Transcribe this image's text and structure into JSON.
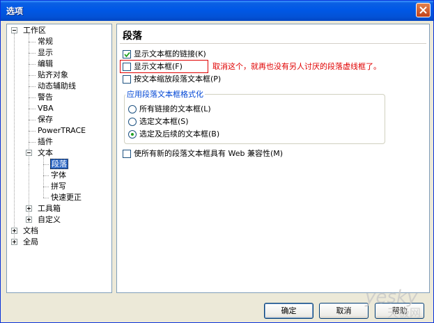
{
  "window": {
    "title": "选项"
  },
  "tree": {
    "items": [
      {
        "label": "工作区",
        "level": 0,
        "expander": "minus"
      },
      {
        "label": "常规",
        "level": 1
      },
      {
        "label": "显示",
        "level": 1
      },
      {
        "label": "编辑",
        "level": 1
      },
      {
        "label": "贴齐对象",
        "level": 1
      },
      {
        "label": "动态辅助线",
        "level": 1
      },
      {
        "label": "警告",
        "level": 1
      },
      {
        "label": "VBA",
        "level": 1
      },
      {
        "label": "保存",
        "level": 1
      },
      {
        "label": "PowerTRACE",
        "level": 1
      },
      {
        "label": "插件",
        "level": 1
      },
      {
        "label": "文本",
        "level": 1,
        "expander": "minus"
      },
      {
        "label": "段落",
        "level": 2,
        "selected": true
      },
      {
        "label": "字体",
        "level": 2
      },
      {
        "label": "拼写",
        "level": 2
      },
      {
        "label": "快速更正",
        "level": 2
      },
      {
        "label": "工具箱",
        "level": 1,
        "expander": "plus"
      },
      {
        "label": "自定义",
        "level": 1,
        "expander": "plus"
      },
      {
        "label": "文档",
        "level": 0,
        "expander": "plus"
      },
      {
        "label": "全局",
        "level": 0,
        "expander": "plus"
      }
    ]
  },
  "panel": {
    "title": "段落",
    "options": {
      "show_linked": {
        "label": "显示文本框的链接(K)",
        "checked": true
      },
      "show_frame": {
        "label": "显示文本框(F)",
        "checked": false
      },
      "scale_paragraph": {
        "label": "按文本缩放段落文本框(P)",
        "checked": false
      },
      "web_compatible": {
        "label": "使所有新的段落文本框具有 Web 兼容性(M)",
        "checked": false
      }
    },
    "annotation": "取消这个，就再也没有另人讨厌的段落虚线框了。",
    "format_group": {
      "legend": "应用段落文本框格式化",
      "radios": [
        {
          "label": "所有链接的文本框(L)",
          "checked": false
        },
        {
          "label": "选定文本框(S)",
          "checked": false
        },
        {
          "label": "选定及后续的文本框(B)",
          "checked": true
        }
      ]
    }
  },
  "buttons": {
    "ok": "确定",
    "cancel": "取消",
    "help": "帮助"
  },
  "watermark": {
    "text": "yesky",
    "subtext": "天极网"
  },
  "colors": {
    "title_bar": "#0058e6",
    "selection": "#316ac5",
    "annotation": "#e00000"
  }
}
